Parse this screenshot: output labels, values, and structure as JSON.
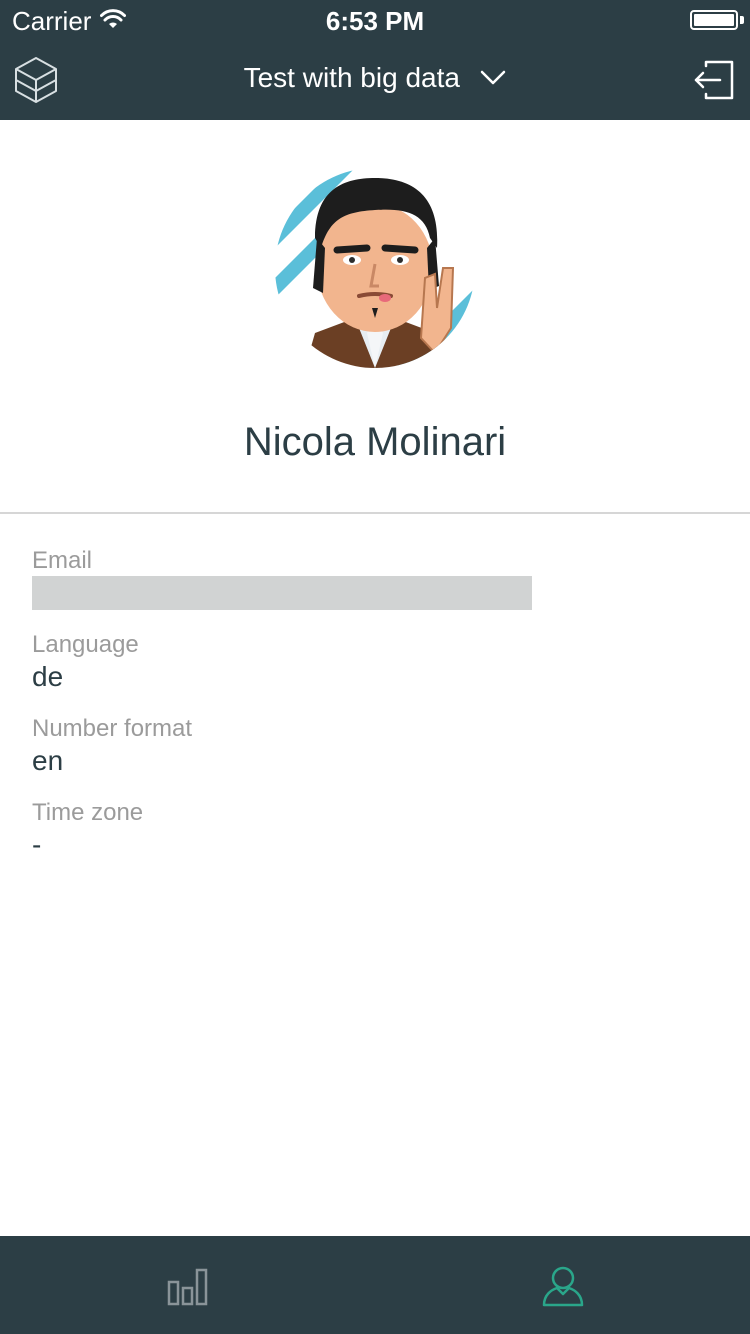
{
  "status_bar": {
    "carrier": "Carrier",
    "time": "6:53 PM"
  },
  "nav": {
    "title": "Test with big data",
    "logo_icon": "cube-logo-icon",
    "dropdown_icon": "chevron-down-icon",
    "logout_icon": "logout-icon"
  },
  "profile": {
    "name": "Nicola Molinari",
    "avatar_icon": "user-avatar"
  },
  "details": {
    "email_label": "Email",
    "email_value": "",
    "language_label": "Language",
    "language_value": "de",
    "number_format_label": "Number format",
    "number_format_value": "en",
    "time_zone_label": "Time zone",
    "time_zone_value": "-"
  },
  "tabbar": {
    "tabs": [
      {
        "icon": "bar-chart-icon",
        "active": false
      },
      {
        "icon": "user-icon",
        "active": true
      }
    ]
  },
  "colors": {
    "header_bg": "#2c3e45",
    "accent": "#2aa68a",
    "inactive_icon": "#8a9499",
    "label_gray": "#9b9b9b",
    "text_dark": "#2c3e45"
  }
}
